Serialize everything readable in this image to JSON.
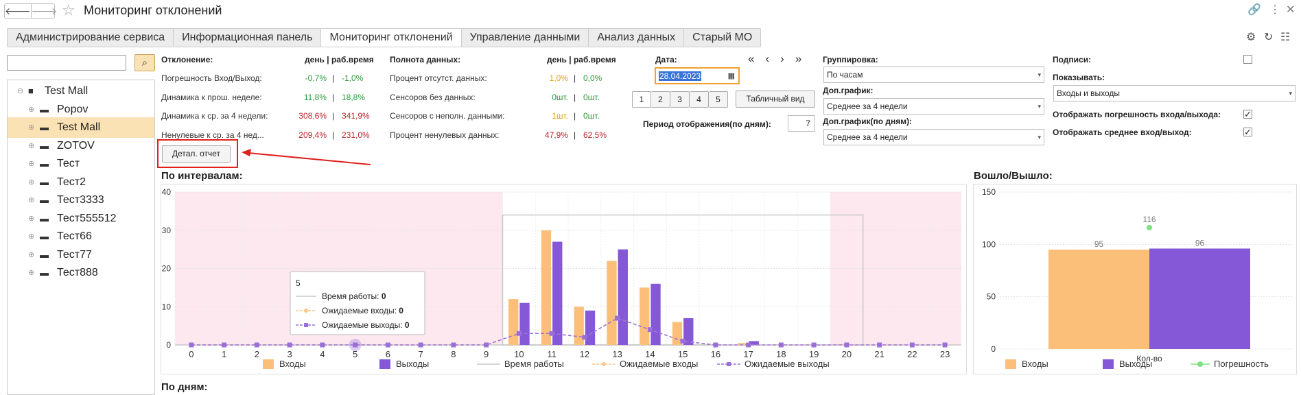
{
  "window": {
    "title": "Мониторинг отклонений"
  },
  "tabs": [
    "Администрирование сервиса",
    "Информационная панель",
    "Мониторинг отклонений",
    "Управление данными",
    "Анализ данных",
    "Старый МО"
  ],
  "active_tab": 2,
  "sidebar": {
    "search_value": "",
    "items": [
      {
        "label": "Test Mall",
        "root": true
      },
      {
        "label": "Popov"
      },
      {
        "label": "Test Mall",
        "selected": true
      },
      {
        "label": "ZOTOV"
      },
      {
        "label": "Тест"
      },
      {
        "label": "Тест2"
      },
      {
        "label": "Тест3333"
      },
      {
        "label": "Тест555512"
      },
      {
        "label": "Тест66"
      },
      {
        "label": "Тест77"
      },
      {
        "label": "Тест888"
      }
    ]
  },
  "deviation": {
    "header": "Отклонение:",
    "col_header": "день | раб.время",
    "rows": [
      {
        "label": "Погрешность Вход/Выход:",
        "day": "-0,7%",
        "work": "-1,0%",
        "color": "green"
      },
      {
        "label": "Динамика к прош. неделе:",
        "day": "11,8%",
        "work": "18,8%",
        "color": "green"
      },
      {
        "label": "Динамика к ср. за 4 недели:",
        "day": "308,6%",
        "work": "341,9%",
        "color": "red"
      },
      {
        "label": "Ненулевые к ср. за 4 нед...",
        "day": "209,4%",
        "work": "231,0%",
        "color": "red"
      }
    ],
    "detail_button": "Детал. отчет"
  },
  "completeness": {
    "header": "Полнота данных:",
    "col_header": "день | раб.время",
    "rows": [
      {
        "label": "Процент отсутст. данных:",
        "day": "1,0%",
        "work": "0,0%",
        "day_color": "orange",
        "work_color": "green"
      },
      {
        "label": "Сенсоров без данных:",
        "day": "0шт.",
        "work": "0шт.",
        "day_color": "green",
        "work_color": "green"
      },
      {
        "label": "Сенсоров с неполн. данными:",
        "day": "1шт.",
        "work": "0шт.",
        "day_color": "orange",
        "work_color": "green"
      },
      {
        "label": "Процент ненулевых данных:",
        "day": "47,9%",
        "work": "62,5%",
        "day_color": "red",
        "work_color": "red"
      }
    ]
  },
  "date": {
    "label": "Дата:",
    "value": "28.04.2023",
    "nav": [
      "«",
      "‹",
      "›",
      "»"
    ],
    "pages": [
      "1",
      "2",
      "3",
      "4",
      "5"
    ],
    "table_view_button": "Табличный вид",
    "period_label": "Период отображения(по дням):",
    "period_value": "7"
  },
  "grouping": {
    "label": "Группировка:",
    "value": "По часам",
    "extra_chart_label": "Доп.график:",
    "extra_chart_value": "Среднее за 4 недели",
    "extra_chart_days_label": "Доп.график(по дням):",
    "extra_chart_days_value": "Среднее за 4 недели"
  },
  "options": {
    "captions_label": "Подписи:",
    "captions_checked": false,
    "show_label": "Показывать:",
    "show_value": "Входы и выходы",
    "show_error_label": "Отображать погрешность входа/выхода:",
    "show_error_checked": true,
    "show_avg_label": "Отображать среднее вход/выход:",
    "show_avg_checked": true
  },
  "sections": {
    "intervals": "По интервалам:",
    "inout": "Вошло/Вышло:",
    "bydays": "По дням:"
  },
  "colors": {
    "entries": "#fbbf7a",
    "exits": "#8458d6",
    "work_time": "#c8c8c8",
    "expected_entries": "#f7c98a",
    "expected_exits": "#9a6fd8",
    "error": "#7fe07f",
    "offhours_bg": "#fde8f0",
    "accent_red": "#e0201a"
  },
  "chart_data": [
    {
      "type": "bar",
      "title": "По интервалам:",
      "categories": [
        "0",
        "1",
        "2",
        "3",
        "4",
        "5",
        "6",
        "7",
        "8",
        "9",
        "10",
        "11",
        "12",
        "13",
        "14",
        "15",
        "16",
        "17",
        "18",
        "19",
        "20",
        "21",
        "22",
        "23"
      ],
      "ylim": [
        0,
        40
      ],
      "yticks": [
        0,
        10,
        20,
        30,
        40
      ],
      "series": [
        {
          "name": "Входы",
          "type": "bar",
          "values": [
            0,
            0,
            0,
            0,
            0,
            0,
            0,
            0,
            0,
            0,
            12,
            30,
            10,
            22,
            15,
            6,
            0,
            0.5,
            0,
            0,
            0,
            0,
            0,
            0
          ]
        },
        {
          "name": "Выходы",
          "type": "bar",
          "values": [
            0,
            0,
            0,
            0,
            0,
            0,
            0,
            0,
            0,
            0,
            11,
            27,
            9,
            25,
            16,
            7,
            0,
            1,
            0,
            0,
            0,
            0,
            0,
            0
          ]
        },
        {
          "name": "Время работы",
          "type": "line",
          "values": [
            0,
            0,
            0,
            0,
            0,
            0,
            0,
            0,
            0,
            0,
            34,
            34,
            34,
            34,
            34,
            34,
            34,
            34,
            34,
            34,
            34,
            0,
            0,
            0
          ]
        },
        {
          "name": "Ожидаемые входы",
          "type": "line",
          "values": [
            0,
            0,
            0,
            0,
            0,
            0,
            0,
            0,
            0,
            0,
            3,
            3,
            2,
            7,
            4,
            1,
            0,
            0,
            0,
            0,
            0,
            0,
            0,
            0
          ]
        },
        {
          "name": "Ожидаемые выходы",
          "type": "line",
          "values": [
            0,
            0,
            0,
            0,
            0,
            0,
            0,
            0,
            0,
            0,
            3,
            3,
            2,
            7,
            4,
            1,
            0,
            0,
            0,
            0,
            0,
            0,
            0,
            0
          ]
        }
      ],
      "tooltip": {
        "title": "5",
        "rows": [
          {
            "label": "Время работы:",
            "value": "0"
          },
          {
            "label": "Ожидаемые входы:",
            "value": "0"
          },
          {
            "label": "Ожидаемые выходы:",
            "value": "0"
          }
        ]
      },
      "legend_position": "bottom",
      "grid": true
    },
    {
      "type": "bar",
      "title": "Вошло/Вышло:",
      "categories": [
        "Кол-во"
      ],
      "ylim": [
        0,
        150
      ],
      "yticks": [
        0,
        50,
        100,
        150
      ],
      "series": [
        {
          "name": "Входы",
          "values": [
            95
          ]
        },
        {
          "name": "Выходы",
          "values": [
            96
          ]
        },
        {
          "name": "Погрешность",
          "type": "point",
          "values": [
            116
          ]
        }
      ],
      "legend_position": "bottom",
      "grid": true
    }
  ]
}
